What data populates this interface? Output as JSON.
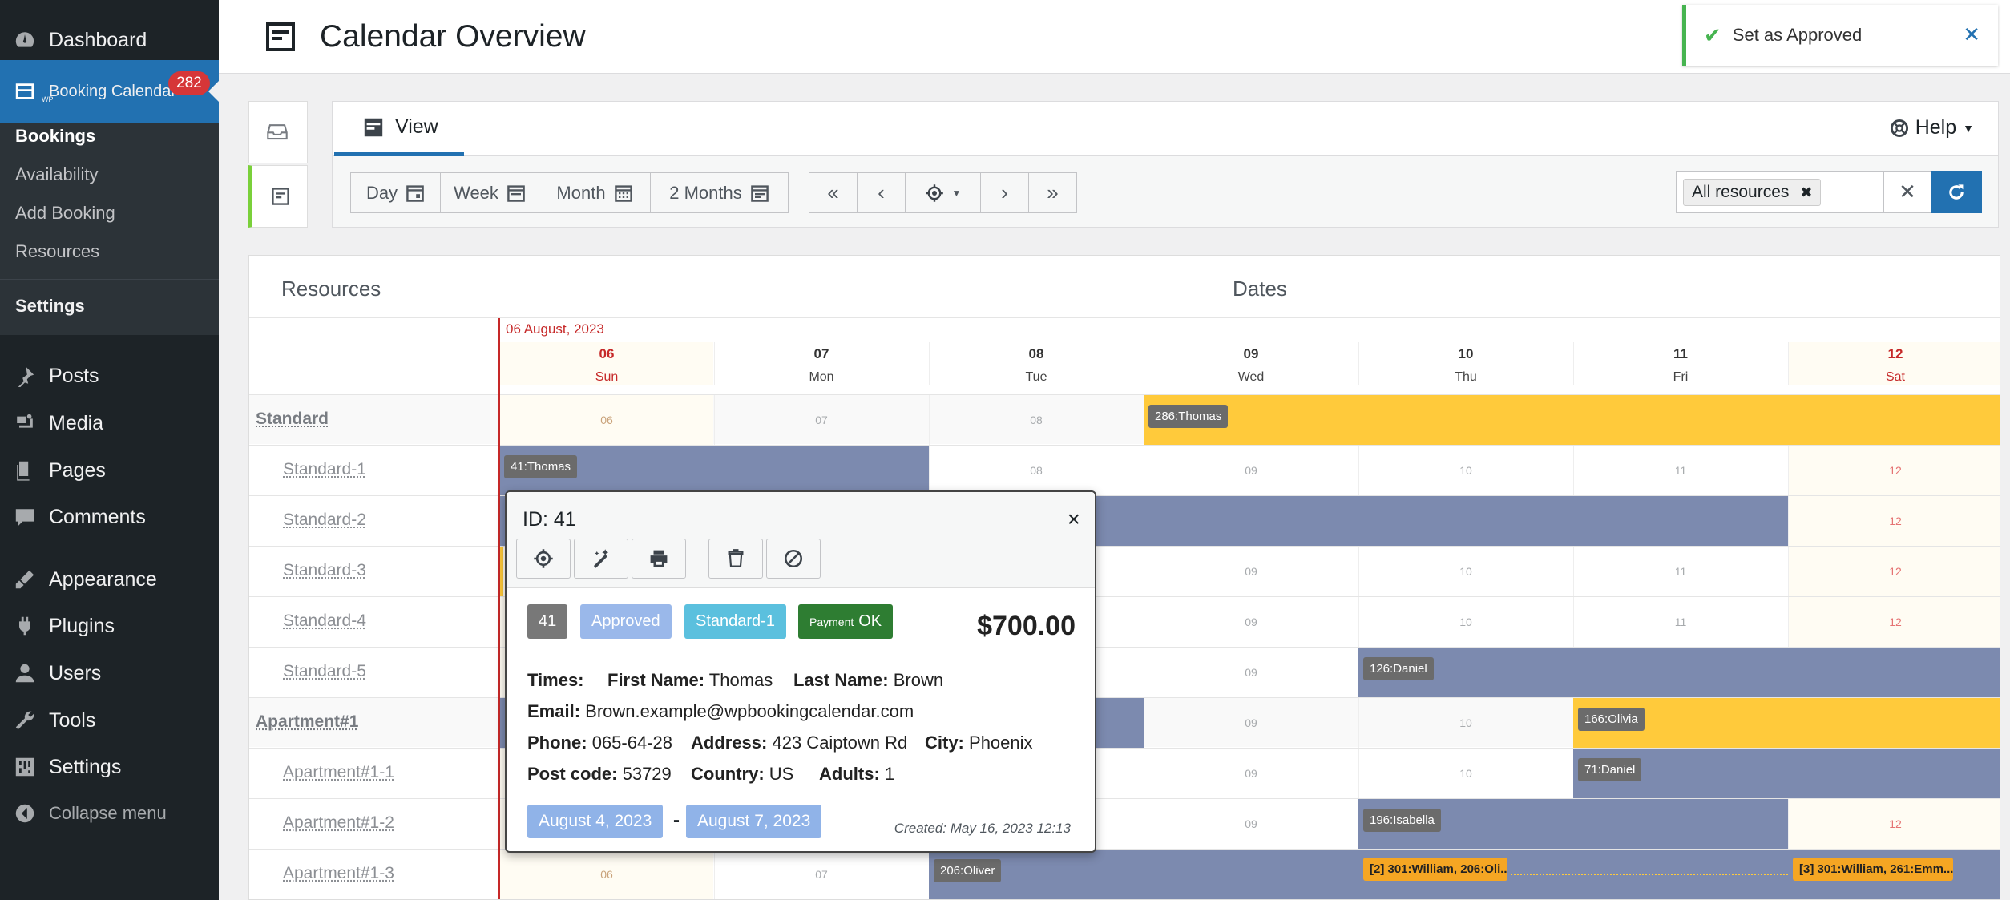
{
  "sidebar": {
    "dashboard": "Dashboard",
    "booking_calendar": "Booking Calendar",
    "booking_calendar_sub": "WP",
    "badge": "282",
    "submenu": [
      "Bookings",
      "Availability",
      "Add Booking",
      "Resources"
    ],
    "settings": "Settings",
    "items": [
      "Posts",
      "Media",
      "Pages",
      "Comments",
      "Appearance",
      "Plugins",
      "Users",
      "Tools",
      "Settings",
      "Collapse menu"
    ]
  },
  "header": {
    "title": "Calendar Overview"
  },
  "toast": {
    "message": "Set as Approved"
  },
  "toolbar": {
    "tab": "View",
    "help": "Help",
    "day": "Day",
    "week": "Week",
    "month": "Month",
    "two_months": "2 Months",
    "resource_chip": "All resources"
  },
  "calendar": {
    "resources_heading": "Resources",
    "dates_heading": "Dates",
    "month_label": "06 August, 2023",
    "days": [
      {
        "num": "06",
        "wd": "Sun",
        "weekend": true
      },
      {
        "num": "07",
        "wd": "Mon",
        "weekend": false
      },
      {
        "num": "08",
        "wd": "Tue",
        "weekend": false
      },
      {
        "num": "09",
        "wd": "Wed",
        "weekend": false
      },
      {
        "num": "10",
        "wd": "Thu",
        "weekend": false
      },
      {
        "num": "11",
        "wd": "Fri",
        "weekend": false
      },
      {
        "num": "12",
        "wd": "Sat",
        "weekend": true
      }
    ],
    "rows": [
      "Standard",
      "Standard-1",
      "Standard-2",
      "Standard-3",
      "Standard-4",
      "Standard-5",
      "Apartment#1",
      "Apartment#1-1",
      "Apartment#1-2",
      "Apartment#1-3"
    ],
    "bookings": {
      "b286": "286:Thomas",
      "b41": "41:Thomas",
      "b126": "126:Daniel",
      "b166": "166:Olivia",
      "b71": "71:Daniel",
      "b196": "196:Isabella",
      "b206": "206:Oliver",
      "b301a": "[2] 301:William, 206:Oli...",
      "b301b": "[3] 301:William, 261:Emm..."
    },
    "cells": {
      "r0": [
        "06",
        "07",
        "08"
      ],
      "r1": [
        "08",
        "09",
        "10",
        "11",
        "12"
      ],
      "r2": [
        "12"
      ],
      "r3": [
        "09",
        "10",
        "11",
        "12"
      ],
      "r4": [
        "09",
        "10",
        "11",
        "12"
      ],
      "r5": [
        "09"
      ],
      "r6": [
        "09",
        "10"
      ],
      "r7": [
        "09",
        "10"
      ],
      "r8": [
        "09",
        "12"
      ],
      "r9": [
        "06",
        "07"
      ]
    }
  },
  "popup": {
    "id": "ID: 41",
    "pill_id": "41",
    "pill_status": "Approved",
    "pill_resource": "Standard-1",
    "pill_payment_small": "Payment",
    "pill_payment_ok": "OK",
    "price": "$700.00",
    "times_label": "Times:",
    "first_name_label": "First Name:",
    "first_name": "Thomas",
    "last_name_label": "Last Name:",
    "last_name": "Brown",
    "email_label": "Email:",
    "email": "Brown.example@wpbookingcalendar.com",
    "phone_label": "Phone:",
    "phone": "065-64-28",
    "address_label": "Address:",
    "address": "423 Caiptown Rd",
    "city_label": "City:",
    "city": "Phoenix",
    "postcode_label": "Post code:",
    "postcode": "53729",
    "country_label": "Country:",
    "country": "US",
    "adults_label": "Adults:",
    "adults": "1",
    "date_from": "August 4, 2023",
    "date_dash": "-",
    "date_to": "August 7, 2023",
    "created": "Created: May 16, 2023 12:13"
  },
  "colors": {
    "accent": "#2271b1",
    "approved_bar": "#7c8aaf",
    "pending_bar": "#ffca3b",
    "today": "#c62828"
  }
}
